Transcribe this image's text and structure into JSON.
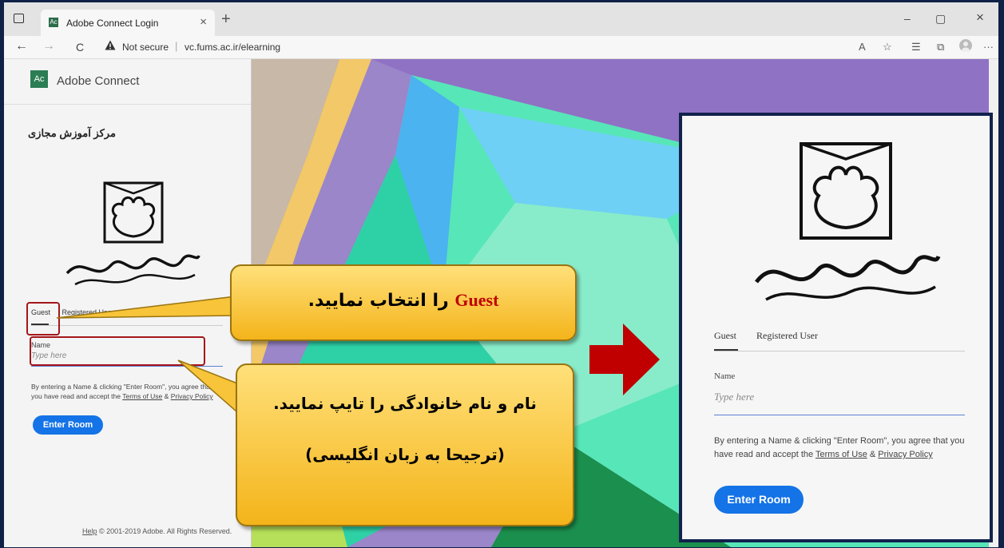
{
  "browser": {
    "tab_title": "Adobe Connect Login",
    "tab_close": "×",
    "new_tab": "+",
    "minimize": "–",
    "restore": "▢",
    "close": "×",
    "back": "←",
    "forward": "→",
    "reload": "C",
    "security_text": "Not secure",
    "separator": "|",
    "url": "vc.fums.ac.ir/elearning",
    "more": "···",
    "read_aloud": "A",
    "favorites": "☆",
    "collections": "⧉"
  },
  "login": {
    "brand": "Adobe Connect",
    "brand_logo_text": "Ac",
    "heading_fa": "مرکز آموزش مجازی",
    "tabs": [
      "Guest",
      "Registered User"
    ],
    "name_label": "Name",
    "name_placeholder": "Type here",
    "terms_prefix": "By entering a Name & clicking \"Enter Room\", you agree that you have read and accept the",
    "terms_link": "Terms of Use",
    "amp": "&",
    "privacy_link": "Privacy Policy",
    "enter_button": "Enter Room",
    "footer_help": "Help",
    "footer_copy": "© 2001-2019 Adobe. All Rights Reserved."
  },
  "callouts": {
    "guest_word": "Guest",
    "guest_rest": "را انتخاب نمایید.",
    "name_line1": "نام و نام خانوادگی را تایپ نمایید.",
    "name_line2": "(ترجیحا به زبان انگلیسی)"
  },
  "colors": {
    "accent_button": "#1473e6",
    "callout_fill": "#fbc633",
    "highlight_border": "#a4161a",
    "arrow": "#c00000",
    "frame_border": "#12224d"
  }
}
